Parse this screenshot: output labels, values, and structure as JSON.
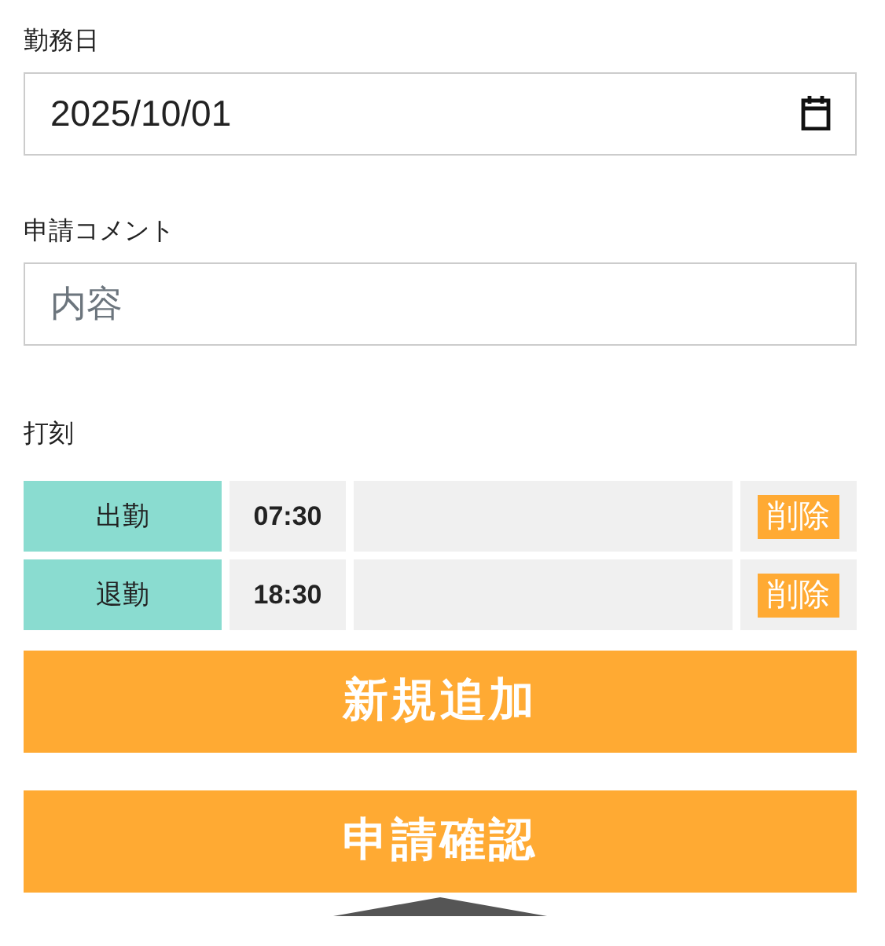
{
  "fields": [
    {
      "kind": "date",
      "label": "勤務日",
      "value": "2025/10/01"
    },
    {
      "kind": "text",
      "label": "申請コメント",
      "placeholder": "内容"
    }
  ],
  "punch": {
    "label": "打刻",
    "rows": [
      {
        "type": "出勤",
        "time": "07:30",
        "action": "削除"
      },
      {
        "type": "退勤",
        "time": "18:30",
        "action": "削除"
      }
    ]
  },
  "buttons": [
    "新規追加",
    "申請確認"
  ]
}
